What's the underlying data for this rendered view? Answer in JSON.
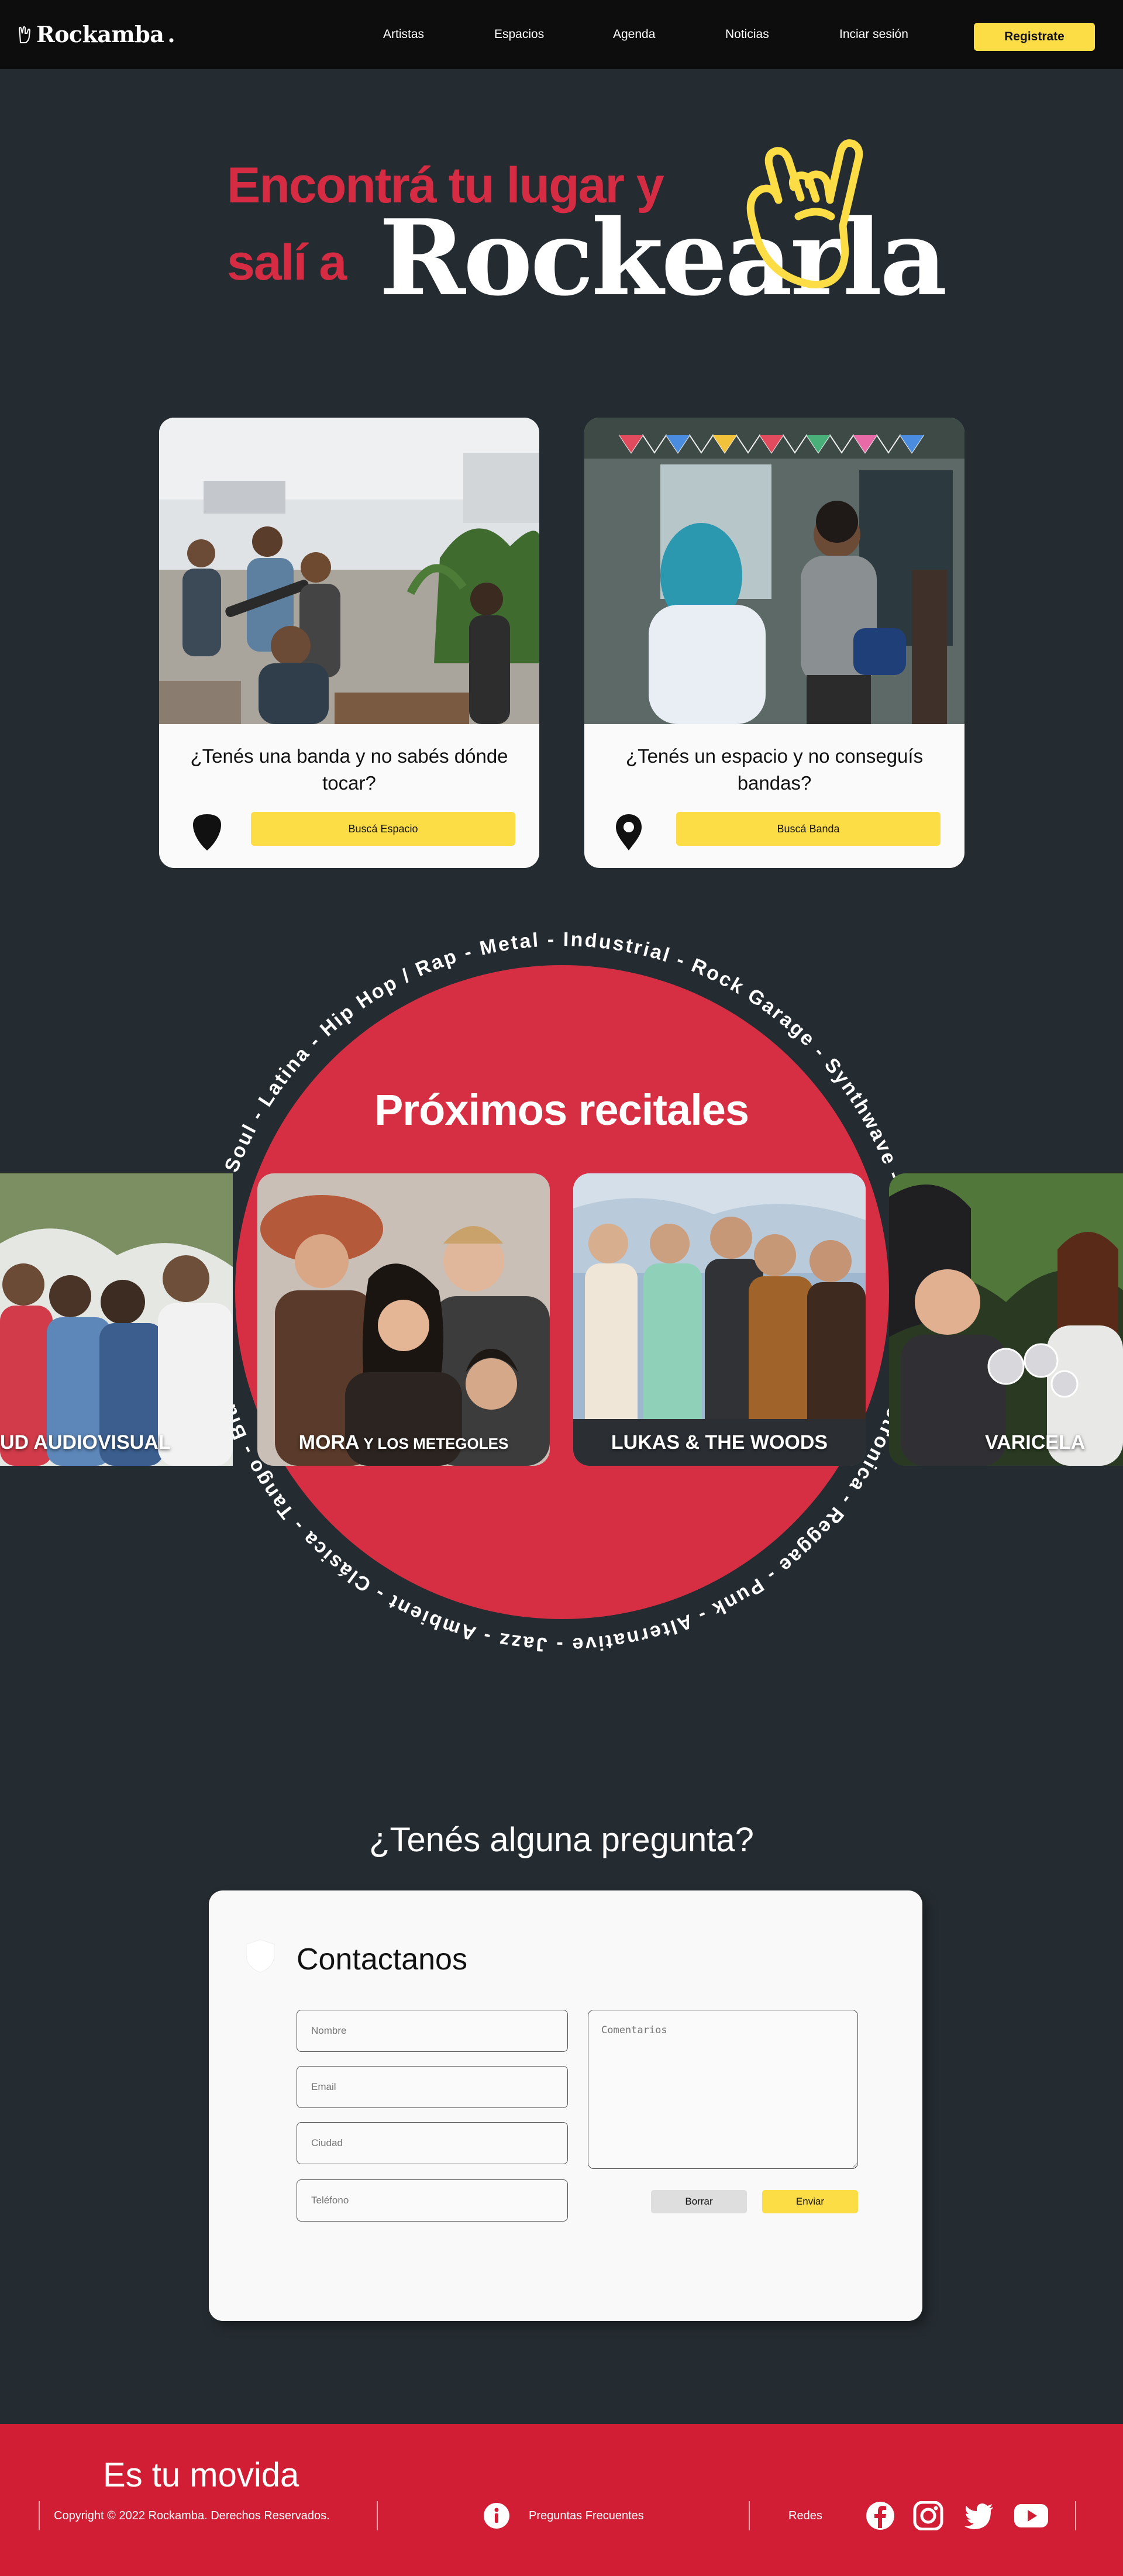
{
  "brand": {
    "name": "Rockamba",
    "dot": "."
  },
  "nav": {
    "links": [
      "Artistas",
      "Espacios",
      "Agenda",
      "Noticias",
      "Inciar sesión"
    ],
    "register_label": "Registrate"
  },
  "hero": {
    "line1": "Encontrá tu lugar y",
    "line2": "salí a",
    "highlight": "Rockearla",
    "hand_color": "#fcdd46",
    "accent_color": "#d52c44"
  },
  "cards": [
    {
      "question": "¿Tenés una banda y no sabés dónde tocar?",
      "icon": "guitar-pick-icon",
      "button": "Buscá Espacio"
    },
    {
      "question": "¿Tenés un espacio y no conseguís bandas?",
      "icon": "map-pin-icon",
      "button": "Buscá Banda"
    }
  ],
  "recitales": {
    "title": "Próximos recitales",
    "ring_text": "Funk - Soul - Latina - Hip Hop / Rap - Metal - Industrial - Rock Garage - Synthwave - Nu Metal - Pop - Electronica - Reggae - Punk - Alternative - Jazz - Ambient - Clásica - Tango - Blues - ",
    "bands": [
      {
        "name_main": "UD AUDIOVISUAL",
        "name_small": ""
      },
      {
        "name_main": "MORA",
        "name_small": " Y LOS METEGOLES"
      },
      {
        "name_main": "LUKAS & THE WOODS",
        "name_small": ""
      },
      {
        "name_main": "VARICELA",
        "name_small": ""
      }
    ]
  },
  "contact": {
    "question": "¿Tenés alguna pregunta?",
    "title": "Contactanos",
    "fields": {
      "nombre": "Nombre",
      "email": "Email",
      "ciudad": "Ciudad",
      "telefono": "Teléfono",
      "comentarios": "Comentarios"
    },
    "borrar": "Borrar",
    "enviar": "Enviar"
  },
  "footer": {
    "slogan": "Es tu movida",
    "copyright": "Copyright © 2022 Rockamba. Derechos Reservados.",
    "faq": "Preguntas Frecuentes",
    "redes": "Redes",
    "socials": [
      "facebook-icon",
      "instagram-icon",
      "twitter-icon",
      "youtube-icon"
    ]
  }
}
